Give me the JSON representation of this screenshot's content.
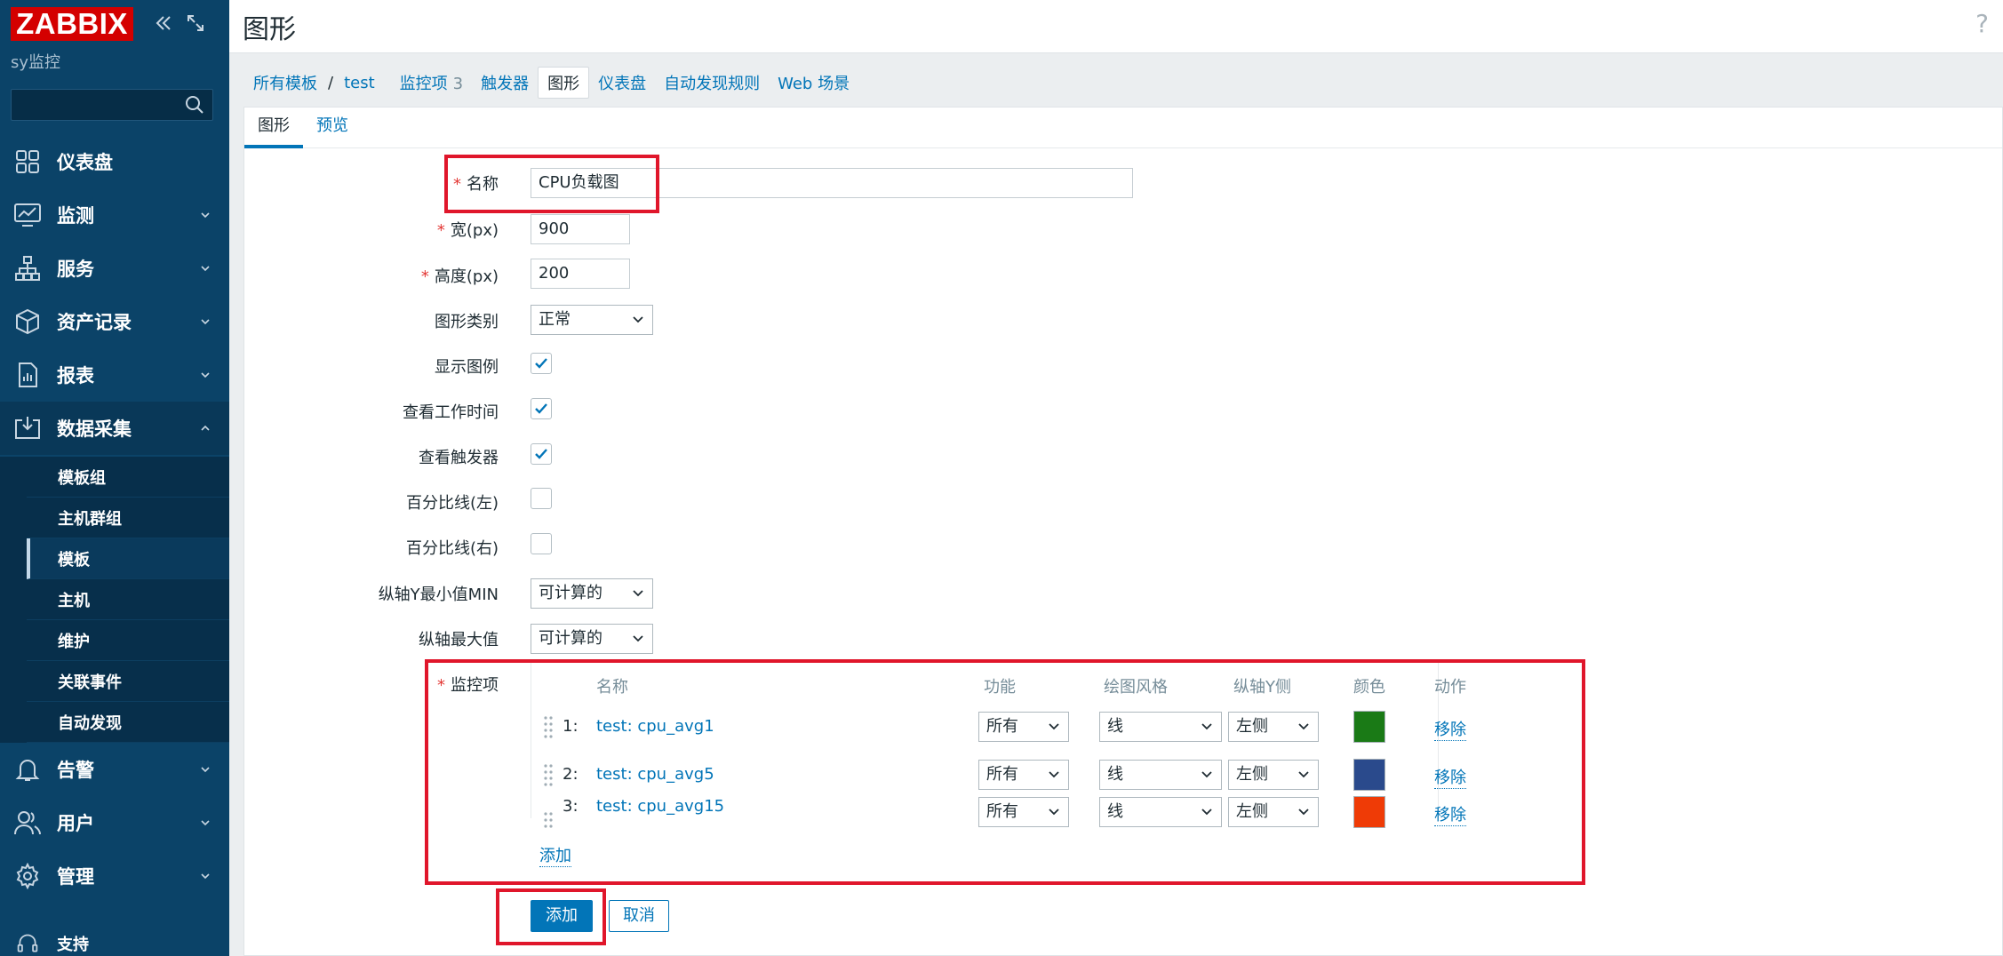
{
  "app": {
    "logo": "ZABBIX",
    "subtitle": "sy监控",
    "colors": {
      "sidebar": "#0b4368",
      "accent": "#0275b8",
      "logo": "#d40000",
      "annotation": "#e0162b"
    }
  },
  "sidebar": {
    "collapse_icon": "double-chevron-left-icon",
    "kiosk_icon": "expand-icon",
    "search_placeholder": "",
    "menu": [
      {
        "label": "仪表盘",
        "icon": "dashboard-icon",
        "chevron": false
      },
      {
        "label": "监测",
        "icon": "monitoring-icon",
        "chevron": true
      },
      {
        "label": "服务",
        "icon": "services-icon",
        "chevron": true
      },
      {
        "label": "资产记录",
        "icon": "inventory-icon",
        "chevron": true
      },
      {
        "label": "报表",
        "icon": "reports-icon",
        "chevron": true
      },
      {
        "label": "数据采集",
        "icon": "data-collection-icon",
        "chevron": true,
        "open": true
      },
      {
        "label": "告警",
        "icon": "alerts-icon",
        "chevron": true
      },
      {
        "label": "用户",
        "icon": "users-icon",
        "chevron": true
      },
      {
        "label": "管理",
        "icon": "administration-icon",
        "chevron": true
      },
      {
        "label": "支持",
        "icon": "support-icon",
        "chevron": false
      }
    ],
    "submenu": [
      {
        "label": "模板组",
        "active": false
      },
      {
        "label": "主机群组",
        "active": false
      },
      {
        "label": "模板",
        "active": true
      },
      {
        "label": "主机",
        "active": false
      },
      {
        "label": "维护",
        "active": false
      },
      {
        "label": "关联事件",
        "active": false
      },
      {
        "label": "自动发现",
        "active": false
      }
    ]
  },
  "header": {
    "title": "图形",
    "help": "?"
  },
  "breadcrumb": {
    "all_templates": "所有模板",
    "separator": "/",
    "template": "test",
    "items": "监控项",
    "items_count": "3",
    "triggers": "触发器",
    "graphs": "图形",
    "dashboards": "仪表盘",
    "discovery": "自动发现规则",
    "web": "Web 场景"
  },
  "tabs": {
    "graph": "图形",
    "preview": "预览"
  },
  "form": {
    "required_mark": "*",
    "name_label": "名称",
    "name_value": "CPU负载图",
    "width_label": "宽(px)",
    "width_value": "900",
    "height_label": "高度(px)",
    "height_value": "200",
    "graph_type_label": "图形类别",
    "graph_type_value": "正常",
    "show_legend_label": "显示图例",
    "show_legend_checked": true,
    "show_working_time_label": "查看工作时间",
    "show_working_time_checked": true,
    "show_triggers_label": "查看触发器",
    "show_triggers_checked": true,
    "percentile_left_label": "百分比线(左)",
    "percentile_left_checked": false,
    "percentile_right_label": "百分比线(右)",
    "percentile_right_checked": false,
    "y_min_label": "纵轴Y最小值MIN",
    "y_min_value": "可计算的",
    "y_max_label": "纵轴最大值",
    "y_max_value": "可计算的",
    "items_label": "监控项",
    "items_table": {
      "headers": [
        "名称",
        "功能",
        "绘图风格",
        "纵轴Y侧",
        "颜色",
        "动作"
      ],
      "rows": [
        {
          "num": "1:",
          "name": "test: cpu_avg1",
          "function": "所有",
          "draw_style": "线",
          "y_side": "左侧",
          "color": "#1a7a16",
          "action": "移除"
        },
        {
          "num": "2:",
          "name": "test: cpu_avg5",
          "function": "所有",
          "draw_style": "线",
          "y_side": "左侧",
          "color": "#2a4a8c",
          "action": "移除"
        },
        {
          "num": "3:",
          "name": "test: cpu_avg15",
          "function": "所有",
          "draw_style": "线",
          "y_side": "左侧",
          "color": "#ef3b06",
          "action": "移除"
        }
      ],
      "add_link": "添加"
    },
    "submit_button": "添加",
    "cancel_button": "取消"
  }
}
